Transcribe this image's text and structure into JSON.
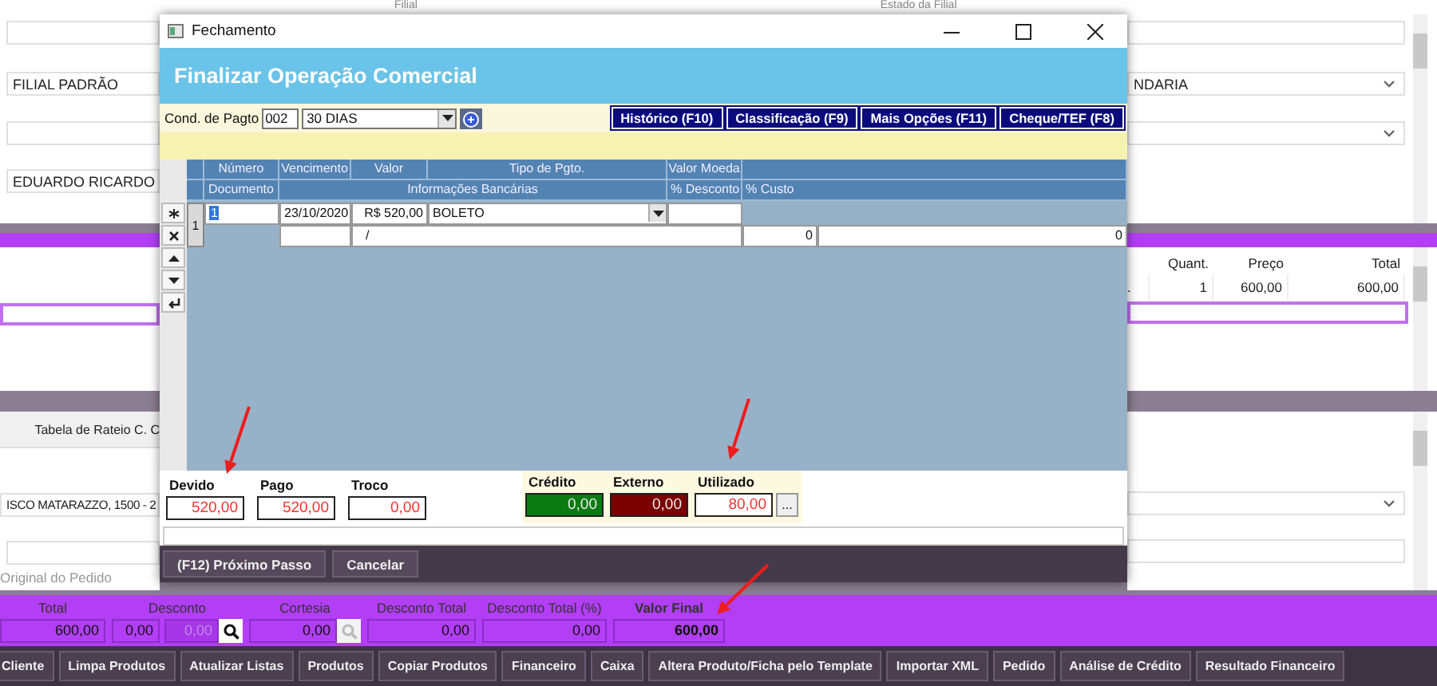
{
  "background": {
    "header_labels": [
      "Filial",
      "Estado da Filial"
    ],
    "left_fields": [
      {
        "dropdown": false
      },
      {
        "value": "FILIAL PADRÃO",
        "dropdown": false
      },
      {
        "dropdown": false
      },
      {
        "value": "EDUARDO RICARDO",
        "dropdown": false
      }
    ],
    "right_fields": [
      {
        "dropdown": false
      },
      {
        "value": "NDARIA",
        "dropdown": true
      },
      {
        "dropdown": true
      }
    ],
    "items_table": {
      "columns": [
        "Quant.",
        "Preço",
        "Total"
      ],
      "rows": [
        {
          "column_1": ".",
          "quant": "1",
          "preco": "600,00",
          "total": "600,00"
        }
      ]
    },
    "lower": {
      "left_header": "Tabela de Rateio C. C",
      "address": "ISCO MATARAZZO, 1500 - 2",
      "caption": "Original do Pedido"
    }
  },
  "dialog": {
    "title": "Fechamento",
    "header": "Finalizar Operação Comercial",
    "payment_condition": {
      "label": "Cond. de Pagto",
      "code": "002",
      "value": "30 DIAS"
    },
    "action_buttons": [
      "Histórico (F10)",
      "Classificação (F9)",
      "Mais Opções (F11)",
      "Cheque/TEF (F8)"
    ],
    "grid": {
      "header_row_1": [
        "Número",
        "Vencimento",
        "Valor",
        "Tipo de Pgto.",
        "Valor Moeda"
      ],
      "header_row_2": [
        "Documento",
        "Informações Bancárias",
        "% Desconto",
        "% Custo"
      ],
      "rows": [
        {
          "indicator": "1",
          "numero": "1",
          "vencimento": "23/10/2020",
          "valor": "R$ 520,00",
          "tipo_pgto": "BOLETO",
          "informacoes_bancarias": "/",
          "desconto": "0",
          "custo": "0"
        }
      ]
    },
    "summary": [
      {
        "kind": "balance",
        "label": "Devido",
        "value": "520,00",
        "color": "#ffffff"
      },
      {
        "kind": "balance",
        "label": "Pago",
        "value": "520,00",
        "color": "#ffffff"
      },
      {
        "kind": "balance",
        "label": "Troco",
        "value": "0,00",
        "color": "#ffffff"
      },
      {
        "kind": "credit",
        "label": "Crédito",
        "value": "0,00",
        "color": "#0a7a12"
      },
      {
        "kind": "credit",
        "label": "Externo",
        "value": "0,00",
        "color": "#7a0000"
      },
      {
        "kind": "credit",
        "label": "Utilizado",
        "value": "80,00",
        "color": "#ffffff",
        "button": "..."
      }
    ],
    "footer_buttons": [
      "(F12) Próximo Passo",
      "Cancelar"
    ]
  },
  "totals": [
    {
      "label": "Total",
      "highlighted": false,
      "fields": [
        {
          "value": "600,00",
          "disabled": false
        }
      ]
    },
    {
      "label": "Desconto",
      "highlighted": false,
      "fields": [
        {
          "value": "0,00",
          "disabled": false
        },
        {
          "value": "0,00",
          "disabled": true
        }
      ],
      "search_button": {
        "disabled": false
      }
    },
    {
      "label": "Cortesia",
      "highlighted": false,
      "fields": [
        {
          "value": "0,00",
          "disabled": false
        }
      ],
      "search_button": {
        "disabled": true
      }
    },
    {
      "label": "Desconto Total",
      "highlighted": false,
      "fields": [
        {
          "value": "0,00",
          "disabled": false
        }
      ]
    },
    {
      "label": "Desconto Total (%)",
      "highlighted": false,
      "fields": [
        {
          "value": "0,00",
          "disabled": false
        }
      ]
    },
    {
      "label": "Valor Final",
      "highlighted": true,
      "fields": [
        {
          "value": "600,00",
          "disabled": false
        }
      ]
    }
  ],
  "toolbar": [
    "Cliente",
    "Limpa Produtos",
    "Atualizar Listas",
    "Produtos",
    "Copiar Produtos",
    "Financeiro",
    "Caixa",
    "Altera Produto/Ficha pelo Template",
    "Importar XML",
    "Pedido",
    "Análise de Crédito",
    "Resultado Financeiro"
  ]
}
